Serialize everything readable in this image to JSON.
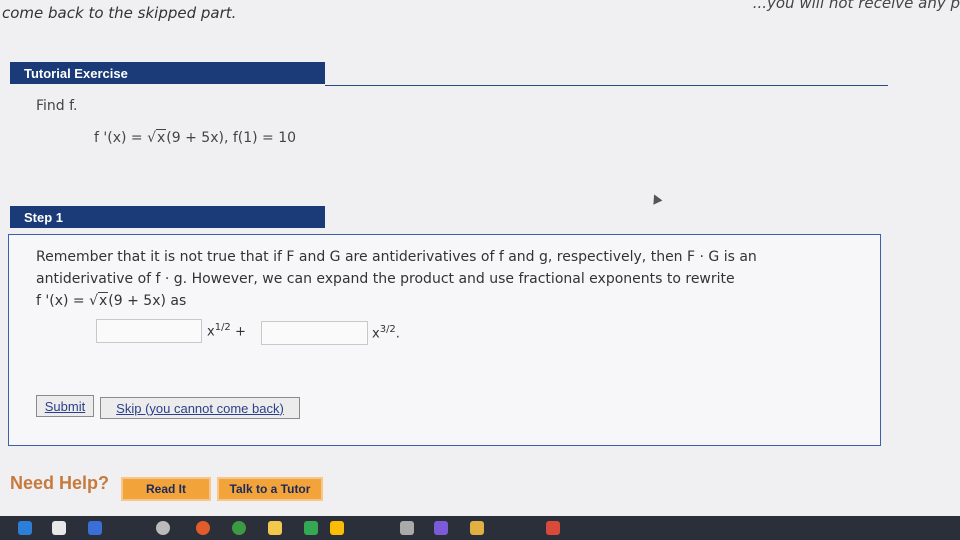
{
  "top_note": "come back to the skipped part.",
  "top_right_cut": "...you will not receive any p",
  "tutorial": {
    "header": "Tutorial Exercise",
    "find_label": "Find f.",
    "given_equation": {
      "lhs": "f '(x) = ",
      "radicand": "x",
      "rest": "(9 + 5x),   f(1) = 10"
    }
  },
  "step": {
    "header": "Step 1",
    "line1": "Remember that it is not true that if F and G are antiderivatives of f and g, respectively, then F · G is an",
    "line2": "antiderivative of f · g. However, we can expand the product and use fractional exponents to rewrite",
    "line3_prefix": "f '(x) = ",
    "line3_radicand": "x",
    "line3_rest": "(9 + 5x)  as",
    "input1_value": "",
    "term1_base": "x",
    "term1_exp": "1/2",
    "plus": "+",
    "input2_value": "",
    "term2_base": "x",
    "term2_exp": "3/2",
    "term2_end": ".",
    "submit_label": "Submit",
    "skip_label": "Skip (you cannot come back)"
  },
  "help": {
    "label": "Need Help?",
    "read_it": "Read It",
    "talk_tutor": "Talk to a Tutor"
  },
  "colors": {
    "header_bg": "#1b3a78",
    "help_orange": "#f2a33a",
    "need_help_text": "#c67a3e"
  }
}
